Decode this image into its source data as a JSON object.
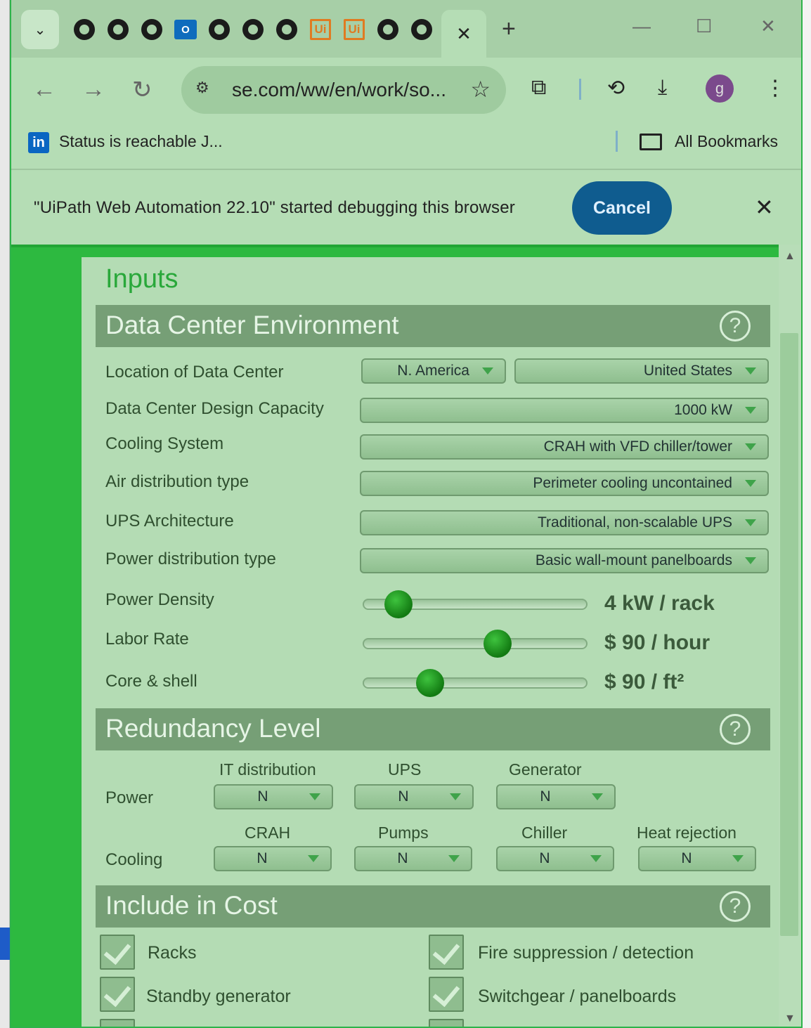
{
  "browser": {
    "tabs": [
      {
        "icon": "github-icon"
      },
      {
        "icon": "github-icon"
      },
      {
        "icon": "github-icon"
      },
      {
        "icon": "outlook-icon",
        "glyph": "O"
      },
      {
        "icon": "github-icon"
      },
      {
        "icon": "github-icon"
      },
      {
        "icon": "github-icon"
      },
      {
        "icon": "uipath-icon",
        "glyph": "Ui"
      },
      {
        "icon": "uipath-icon",
        "glyph": "Ui"
      },
      {
        "icon": "github-icon"
      },
      {
        "icon": "github-icon"
      }
    ],
    "active_tab_close": "✕",
    "new_tab": "+",
    "url": "se.com/ww/en/work/so...",
    "avatar_letter": "g",
    "bookmark_label": "Status is reachable J...",
    "bookmark_logo": "in",
    "all_bookmarks": "All Bookmarks"
  },
  "infobar": {
    "message": "\"UiPath Web Automation 22.10\" started debugging this browser",
    "cancel": "Cancel"
  },
  "page": {
    "title": "Inputs",
    "env": {
      "heading": "Data Center Environment",
      "location_label": "Location of Data Center",
      "region": "N. America",
      "country": "United States",
      "capacity_label": "Data Center Design Capacity",
      "capacity": "1000 kW",
      "cooling_label": "Cooling System",
      "cooling": "CRAH with VFD chiller/tower",
      "air_label": "Air distribution type",
      "air": "Perimeter cooling uncontained",
      "ups_label": "UPS Architecture",
      "ups": "Traditional, non-scalable UPS",
      "pdist_label": "Power distribution type",
      "pdist": "Basic wall-mount panelboards",
      "density_label": "Power Density",
      "density_value": "4 kW / rack",
      "density_level": 0.16,
      "labor_label": "Labor Rate",
      "labor_value": "$ 90 / hour",
      "labor_level": 0.6,
      "shell_label": "Core & shell",
      "shell_value": "$ 90 / ft²",
      "shell_level": 0.3
    },
    "redundancy": {
      "heading": "Redundancy Level",
      "power_label": "Power",
      "cooling_label": "Cooling",
      "power_cols": [
        "IT distribution",
        "UPS",
        "Generator"
      ],
      "power_vals": [
        "N",
        "N",
        "N"
      ],
      "cooling_cols": [
        "CRAH",
        "Pumps",
        "Chiller",
        "Heat rejection"
      ],
      "cooling_vals": [
        "N",
        "N",
        "N",
        "N"
      ]
    },
    "cost": {
      "heading": "Include in Cost",
      "items": [
        "Racks",
        "Fire suppression / detection",
        "Standby generator",
        "Switchgear / panelboards"
      ]
    }
  },
  "colors": {
    "accent_green": "#2db940",
    "section_header": "#769f76",
    "cancel_button": "#0f5c8f"
  }
}
